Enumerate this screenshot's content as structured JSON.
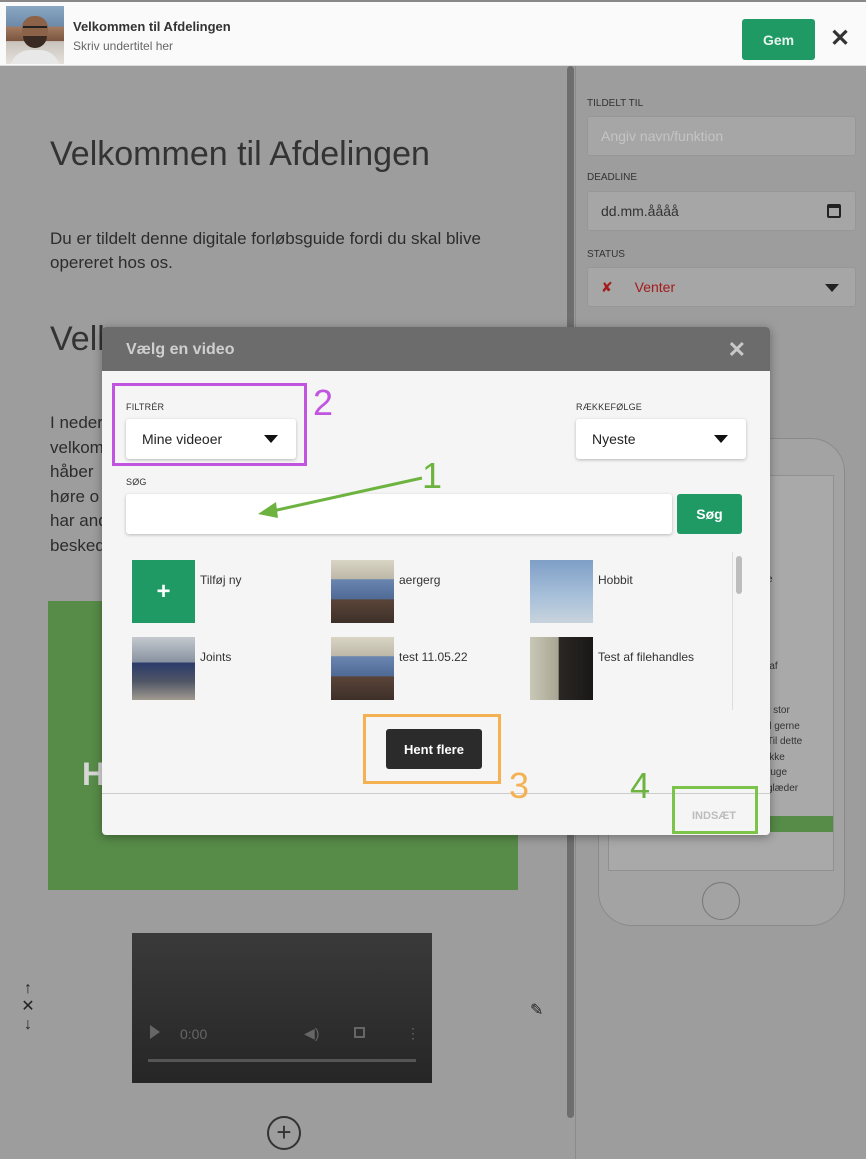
{
  "header": {
    "title": "Velkommen til Afdelingen",
    "subtitle": "Skriv undertitel her",
    "save_label": "Gem",
    "close_glyph": "✕"
  },
  "editor": {
    "heading": "Velkommen til Afdelingen",
    "intro": "Du er tildelt denne digitale forløbsguide fordi du skal blive opereret hos os.",
    "heading2": "Vell",
    "para_fragment": "I neder\nvelkom\nhåber\nhøre o\nhar and\nbesked",
    "green_block_text": "H",
    "video_time": "0:00",
    "arrow_up": "↑",
    "remove_glyph": "✕",
    "arrow_down": "↓",
    "pencil_glyph": "✎",
    "add_glyph": "+"
  },
  "panel": {
    "assigned_label": "TILDELT TIL",
    "assigned_placeholder": "Angiv navn/funktion",
    "deadline_label": "DEADLINE",
    "deadline_value": "dd.mm.åååå",
    "status_label": "STATUS",
    "status_glyph": "✘",
    "status_value": "Venter",
    "phone_text": [
      "e",
      "n af",
      "r stor",
      "il gerne",
      "Til dette",
      "ikke",
      "ruge",
      "glæder"
    ]
  },
  "modal": {
    "title": "Vælg en video",
    "close_glyph": "✕",
    "filter_label": "FILTRÉR",
    "filter_value": "Mine videoer",
    "order_label": "RÆKKEFØLGE",
    "order_value": "Nyeste",
    "search_label": "SØG",
    "search_value": "",
    "search_button": "Søg",
    "videos": [
      {
        "label": "Tilføj ny",
        "thumb": "add-new",
        "glyph": "+"
      },
      {
        "label": "aergerg",
        "thumb": "man-with-bicycle"
      },
      {
        "label": "Hobbit",
        "thumb": "blue-sky"
      },
      {
        "label": "Joints",
        "thumb": "street-building"
      },
      {
        "label": "test 11.05.22",
        "thumb": "man-with-bicycle"
      },
      {
        "label": "Test af filehandles",
        "thumb": "dark-figure"
      }
    ],
    "load_more": "Hent flere",
    "insert": "INDSÆT"
  },
  "annotations": [
    {
      "number": "1",
      "color": "#6db33f",
      "target": "search-input"
    },
    {
      "number": "2",
      "color": "#c155e0",
      "target": "filter-select"
    },
    {
      "number": "3",
      "color": "#f4b152",
      "target": "load-more-button"
    },
    {
      "number": "4",
      "color": "#6db33f",
      "target": "insert-button"
    }
  ],
  "colors": {
    "brand_green": "#1f9a64",
    "status_red": "#a31b1b"
  }
}
